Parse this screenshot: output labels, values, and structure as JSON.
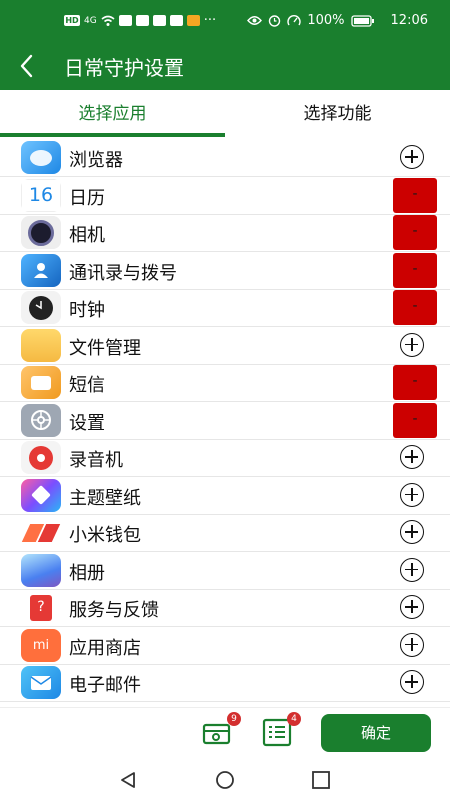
{
  "status_bar": {
    "left_labels": [
      "HD",
      "4G"
    ],
    "battery": "100%",
    "time": "12:06"
  },
  "app_bar": {
    "title": "日常守护设置"
  },
  "tabs": [
    {
      "label": "选择应用",
      "selected": true
    },
    {
      "label": "选择功能",
      "selected": false
    }
  ],
  "apps": [
    {
      "name": "浏览器",
      "icon": "browser-icon",
      "action": "add"
    },
    {
      "name": "日历",
      "icon": "calendar-icon",
      "icon_text": "16",
      "action": "remove"
    },
    {
      "name": "相机",
      "icon": "camera-icon",
      "action": "remove"
    },
    {
      "name": "通讯录与拨号",
      "icon": "contacts-icon",
      "action": "remove"
    },
    {
      "name": "时钟",
      "icon": "clock-icon",
      "action": "remove"
    },
    {
      "name": "文件管理",
      "icon": "folder-icon",
      "action": "add"
    },
    {
      "name": "短信",
      "icon": "message-icon",
      "action": "remove"
    },
    {
      "name": "设置",
      "icon": "gear-icon",
      "action": "remove"
    },
    {
      "name": "录音机",
      "icon": "recorder-icon",
      "action": "add"
    },
    {
      "name": "主题壁纸",
      "icon": "theme-icon",
      "action": "add"
    },
    {
      "name": "小米钱包",
      "icon": "wallet-icon",
      "action": "add"
    },
    {
      "name": "相册",
      "icon": "gallery-icon",
      "action": "add"
    },
    {
      "name": "服务与反馈",
      "icon": "feedback-icon",
      "action": "add"
    },
    {
      "name": "应用商店",
      "icon": "app-store-icon",
      "icon_text": "mi",
      "action": "add"
    },
    {
      "name": "电子邮件",
      "icon": "mail-icon",
      "action": "add"
    }
  ],
  "remove_label": "-",
  "bottom_bar": {
    "apps_badge": "9",
    "functions_badge": "4",
    "confirm_label": "确定"
  },
  "colors": {
    "primary": "#1a7f2e",
    "remove": "#cc0000",
    "badge": "#d32f2f"
  }
}
